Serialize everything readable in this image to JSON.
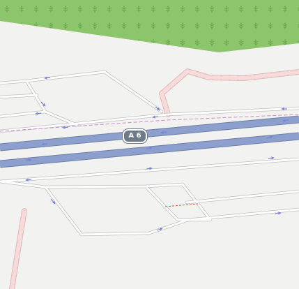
{
  "map": {
    "motorway_ref": "A 6",
    "colors": {
      "background": "#f2f2f0",
      "forest": "#8dc56c",
      "forest_symbol": "#69a84a",
      "motorway": "#8c9fcd",
      "motorway_casing": "#6e7da6",
      "road": "#ffffff",
      "road_casing": "#bdbdbd",
      "path": "#f7dada",
      "path_casing": "#e0b9b9",
      "oneway_arrow": "#7b83d8",
      "boundary": "#c98cc6",
      "track": "#e1533b",
      "shield": "#6d7a87"
    },
    "features": [
      "forest",
      "motorway",
      "service-roads",
      "footpaths",
      "dashed-boundary",
      "track"
    ]
  }
}
